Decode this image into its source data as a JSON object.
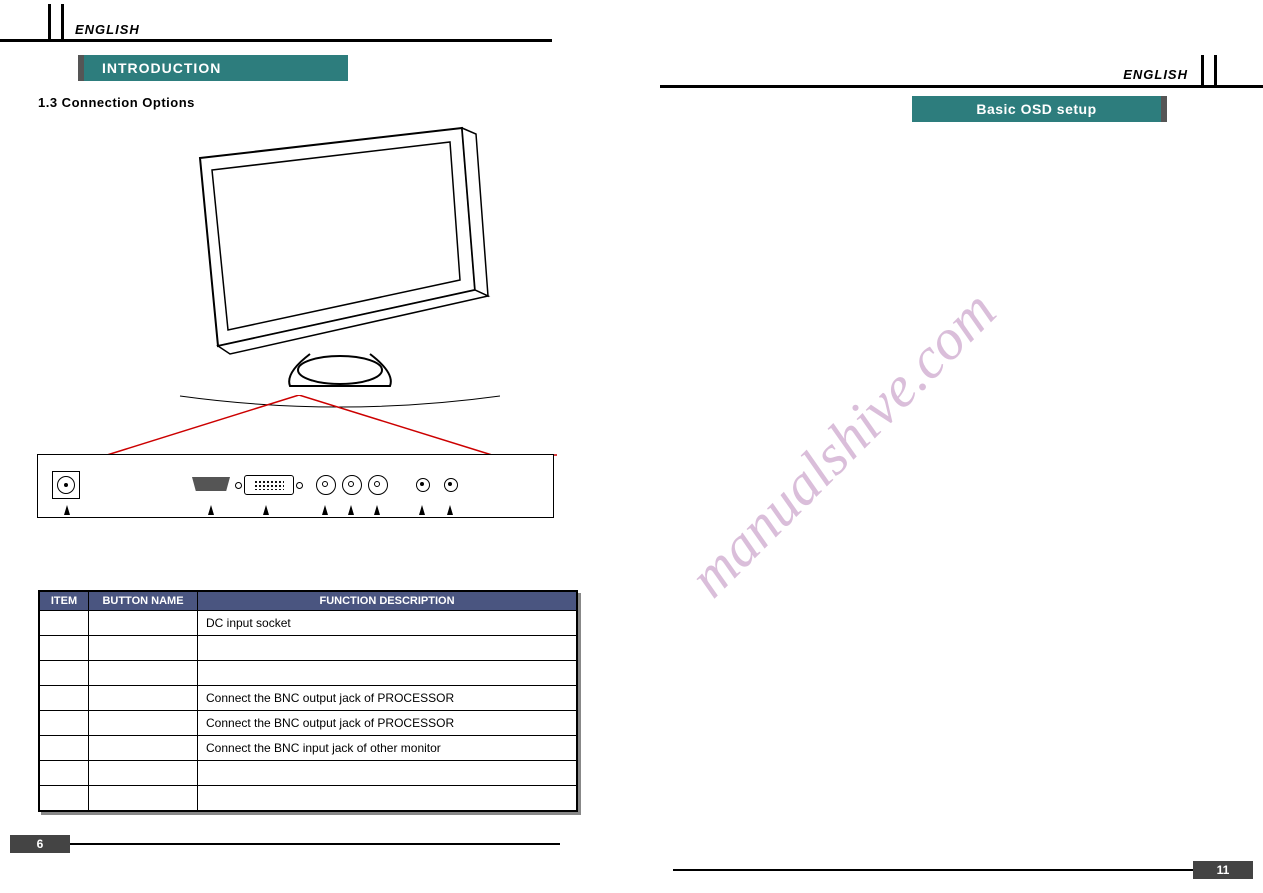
{
  "left_page": {
    "language": "ENGLISH",
    "tab_title": "INTRODUCTION",
    "section_title": "1.3 Connection Options",
    "page_number": "6"
  },
  "right_page": {
    "language": "ENGLISH",
    "tab_title": "Basic OSD setup",
    "page_number": "11"
  },
  "watermark": "manualshive.com",
  "table": {
    "headers": {
      "item": "ITEM",
      "button_name": "BUTTON NAME",
      "function": "FUNCTION DESCRIPTION"
    },
    "rows": [
      {
        "item": "",
        "button_name": "",
        "function": "DC input socket"
      },
      {
        "item": "",
        "button_name": "",
        "function": ""
      },
      {
        "item": "",
        "button_name": "",
        "function": ""
      },
      {
        "item": "",
        "button_name": "",
        "function": "Connect the BNC output jack of PROCESSOR"
      },
      {
        "item": "",
        "button_name": "",
        "function": "Connect the BNC output jack of PROCESSOR"
      },
      {
        "item": "",
        "button_name": "",
        "function": "Connect the BNC input jack of other monitor"
      },
      {
        "item": "",
        "button_name": "",
        "function": ""
      },
      {
        "item": "",
        "button_name": "",
        "function": ""
      }
    ]
  }
}
